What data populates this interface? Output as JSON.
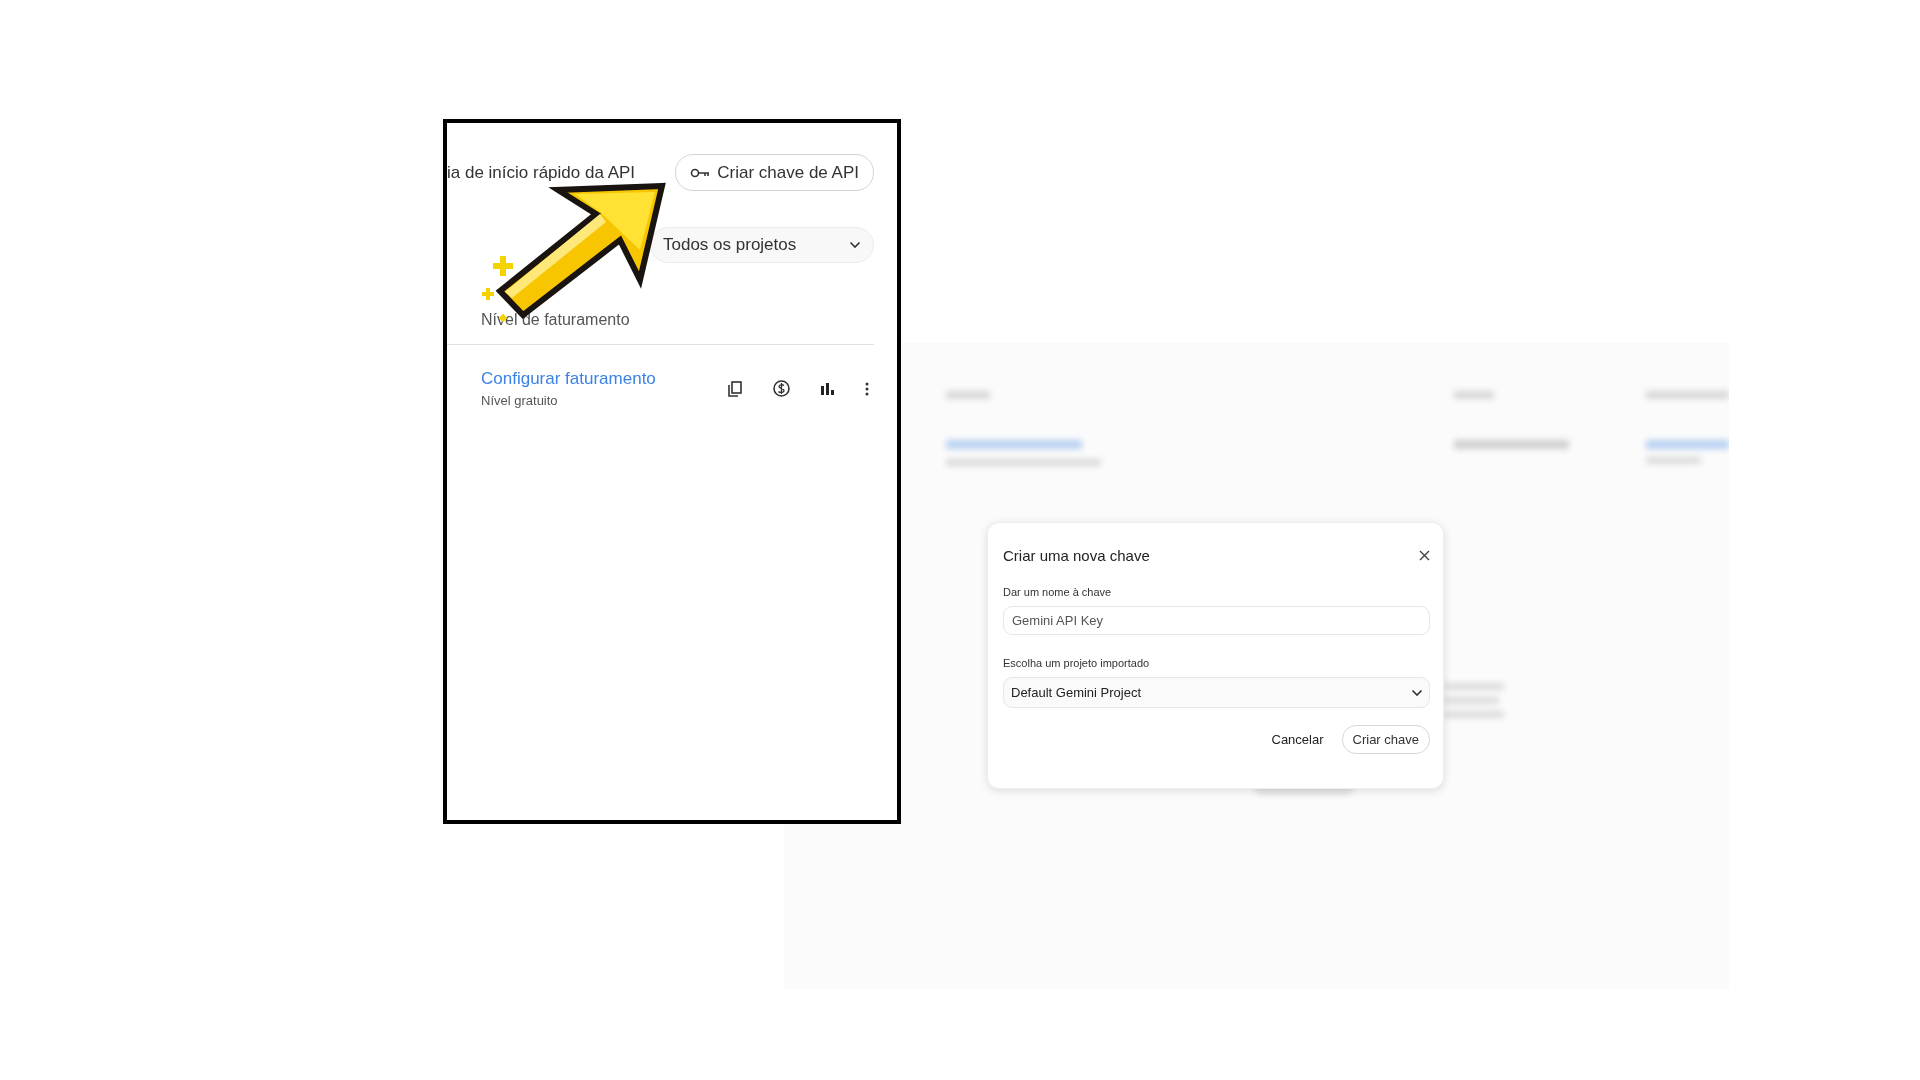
{
  "inset": {
    "breadcrumb": "ia de início rápido da API",
    "create_button": "Criar chave de API",
    "project_filter": "Todos os projetos",
    "column_header": "Nível de faturamento",
    "row": {
      "billing_link": "Configurar faturamento",
      "tier": "Nível gratuito"
    }
  },
  "dialog": {
    "title": "Criar uma nova chave",
    "name_label": "Dar um nome à chave",
    "name_value": "Gemini API Key",
    "project_label": "Escolha um projeto importado",
    "project_value": "Default Gemini Project",
    "buttons": [
      {
        "label": "Cancelar",
        "kind": "text"
      },
      {
        "label": "Criar chave",
        "kind": "outlined"
      }
    ]
  }
}
